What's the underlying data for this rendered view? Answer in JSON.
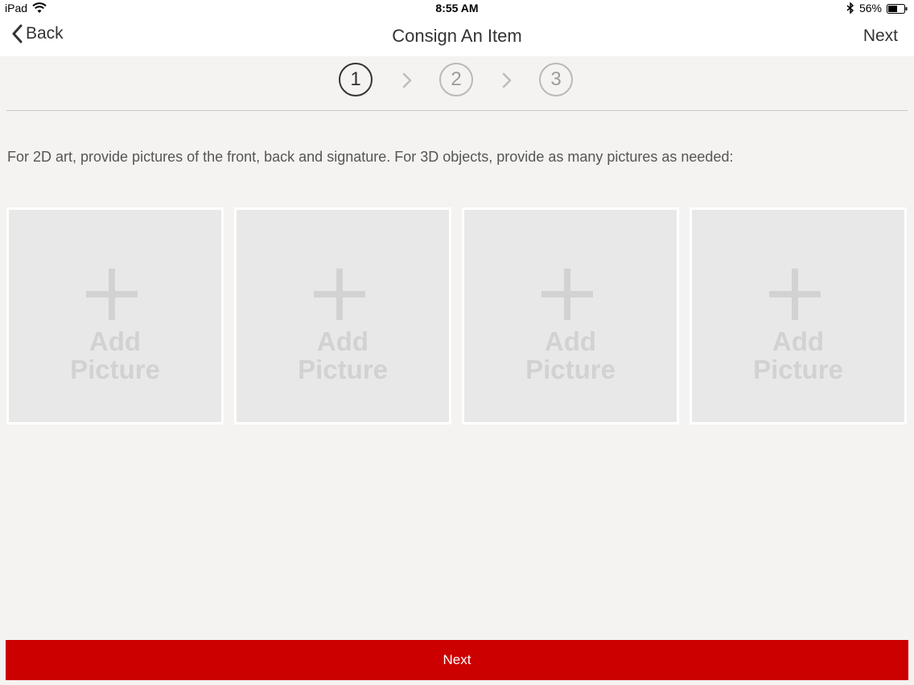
{
  "status_bar": {
    "device": "iPad",
    "time": "8:55 AM",
    "battery": "56%"
  },
  "nav": {
    "back_label": "Back",
    "title": "Consign An Item",
    "next_label": "Next"
  },
  "stepper": {
    "steps": [
      "1",
      "2",
      "3"
    ],
    "active_step": "1"
  },
  "instructions": "For 2D art, provide pictures of the front, back and signature.  For 3D objects, provide as many pictures as needed:",
  "tiles": [
    {
      "line1": "Add",
      "line2": "Picture"
    },
    {
      "line1": "Add",
      "line2": "Picture"
    },
    {
      "line1": "Add",
      "line2": "Picture"
    },
    {
      "line1": "Add",
      "line2": "Picture"
    }
  ],
  "bottom_button": {
    "label": "Next"
  },
  "colors": {
    "accent": "#cd0000",
    "background": "#f4f3f1",
    "tile": "#e9e8e8"
  }
}
